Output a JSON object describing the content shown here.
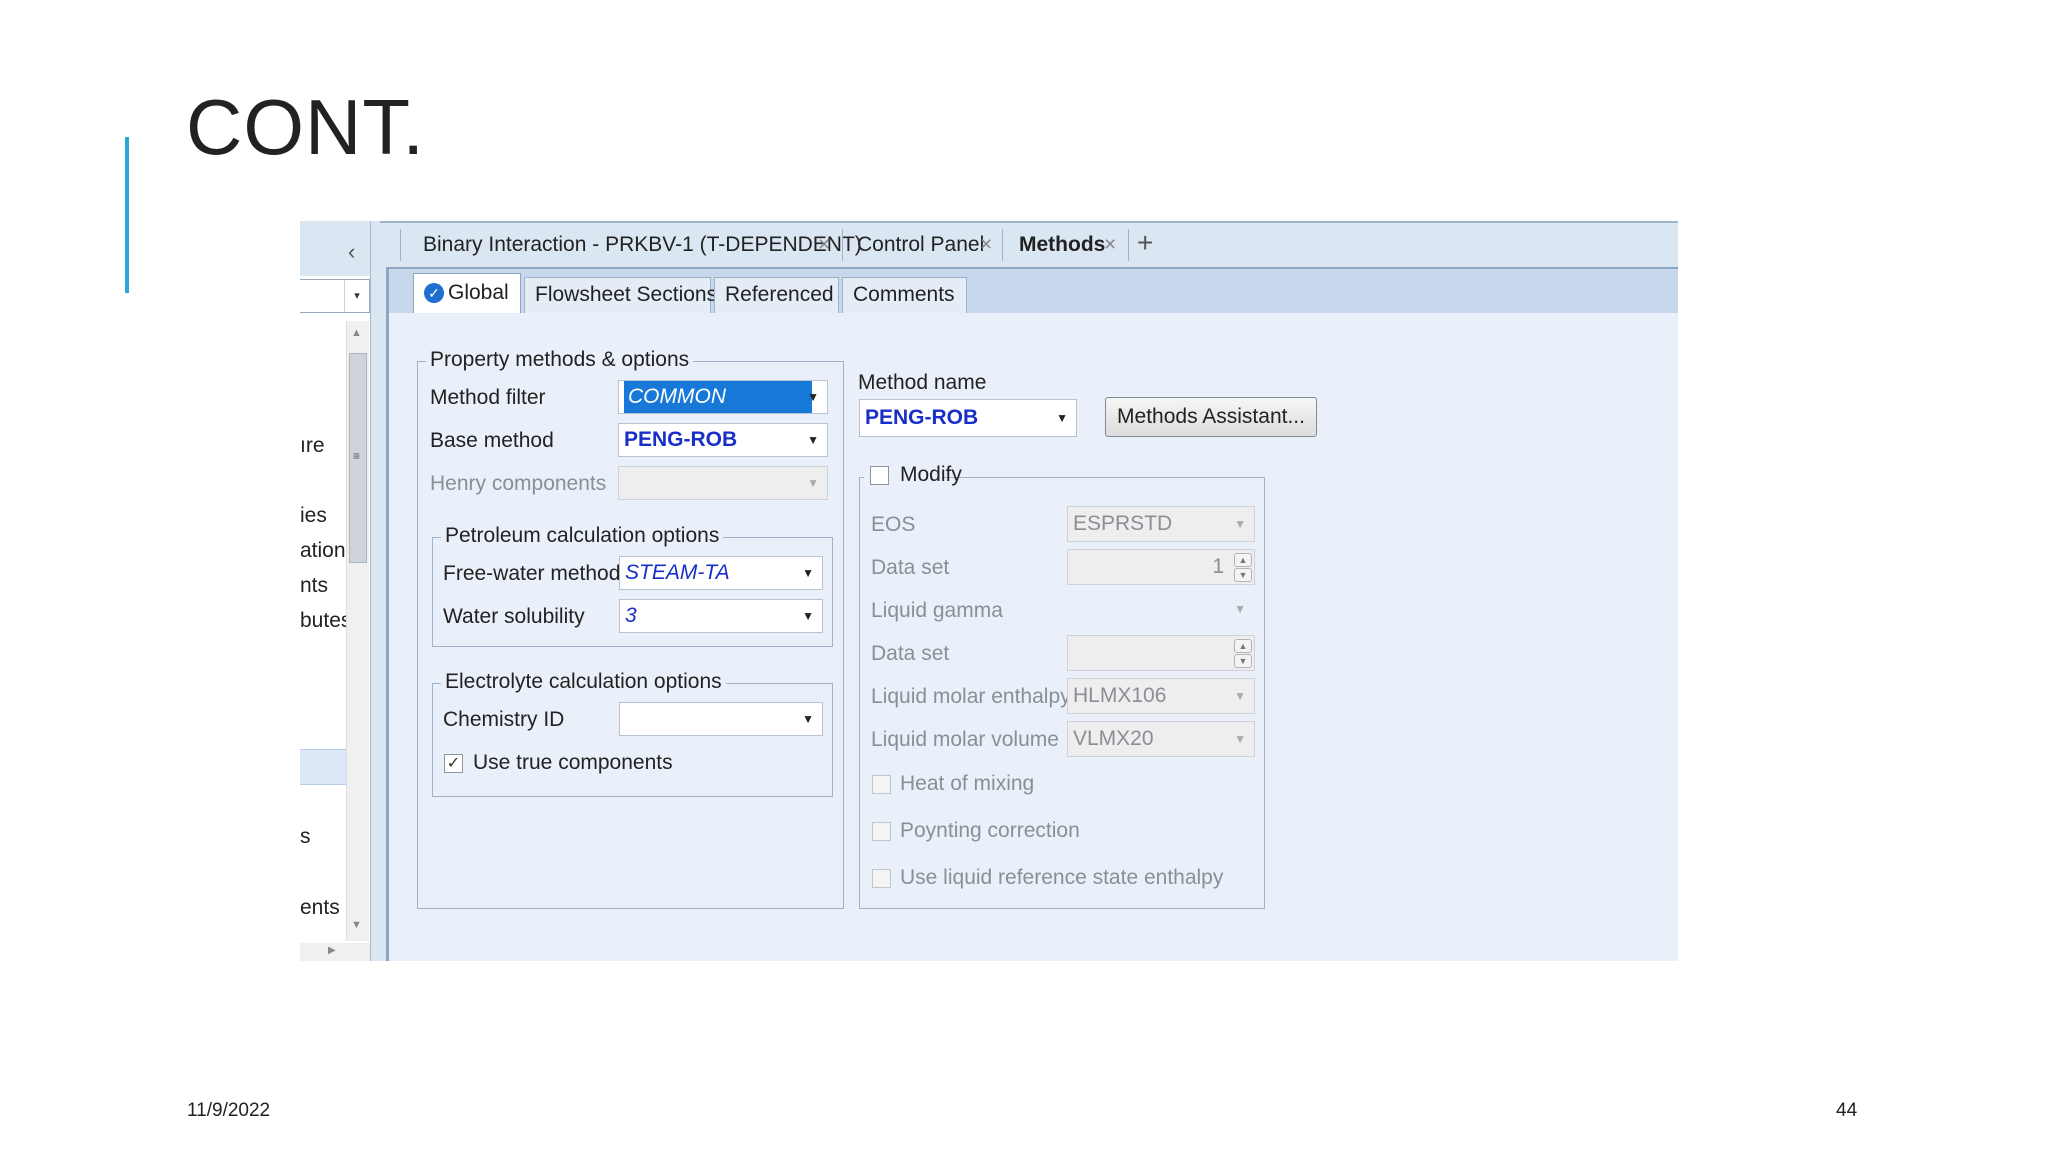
{
  "slide": {
    "title": "CONT.",
    "date": "11/9/2022",
    "page_number": "44",
    "accent_color": "#2aa7d7"
  },
  "nav": {
    "items": [
      "ıre",
      "ies",
      "ation",
      "nts",
      "butes",
      "s",
      "ents"
    ]
  },
  "doc_tabs": [
    {
      "label": "Binary Interaction - PRKBV-1 (T-DEPENDENT)",
      "close": "×"
    },
    {
      "label": "Control Panel",
      "close": "×"
    },
    {
      "label": "Methods",
      "close": "×"
    }
  ],
  "doc_tab_add": "+",
  "sub_tabs": [
    "Global",
    "Flowsheet Sections",
    "Referenced",
    "Comments"
  ],
  "property_methods": {
    "title": "Property methods & options",
    "method_filter_label": "Method filter",
    "method_filter_value": "COMMON",
    "base_method_label": "Base method",
    "base_method_value": "PENG-ROB",
    "henry_label": "Henry components",
    "petroleum": {
      "title": "Petroleum calculation options",
      "free_water_label": "Free-water method",
      "free_water_value": "STEAM-TA",
      "water_solubility_label": "Water solubility",
      "water_solubility_value": "3"
    },
    "electrolyte": {
      "title": "Electrolyte calculation options",
      "chemistry_label": "Chemistry ID",
      "chemistry_value": "",
      "use_true_label": "Use true components",
      "use_true_checked": true
    }
  },
  "method_name": {
    "label": "Method name",
    "value": "PENG-ROB",
    "assistant_button": "Methods Assistant..."
  },
  "modify": {
    "title": "Modify",
    "checked": false,
    "eos_label": "EOS",
    "eos_value": "ESPRSTD",
    "dataset1_label": "Data set",
    "dataset1_value": "1",
    "liquid_gamma_label": "Liquid gamma",
    "dataset2_label": "Data set",
    "liquid_enthalpy_label": "Liquid molar enthalpy",
    "liquid_enthalpy_value": "HLMX106",
    "liquid_volume_label": "Liquid molar volume",
    "liquid_volume_value": "VLMX20",
    "heat_mixing_label": "Heat of mixing",
    "poynting_label": "Poynting correction",
    "liquid_ref_label": "Use liquid reference state enthalpy"
  }
}
